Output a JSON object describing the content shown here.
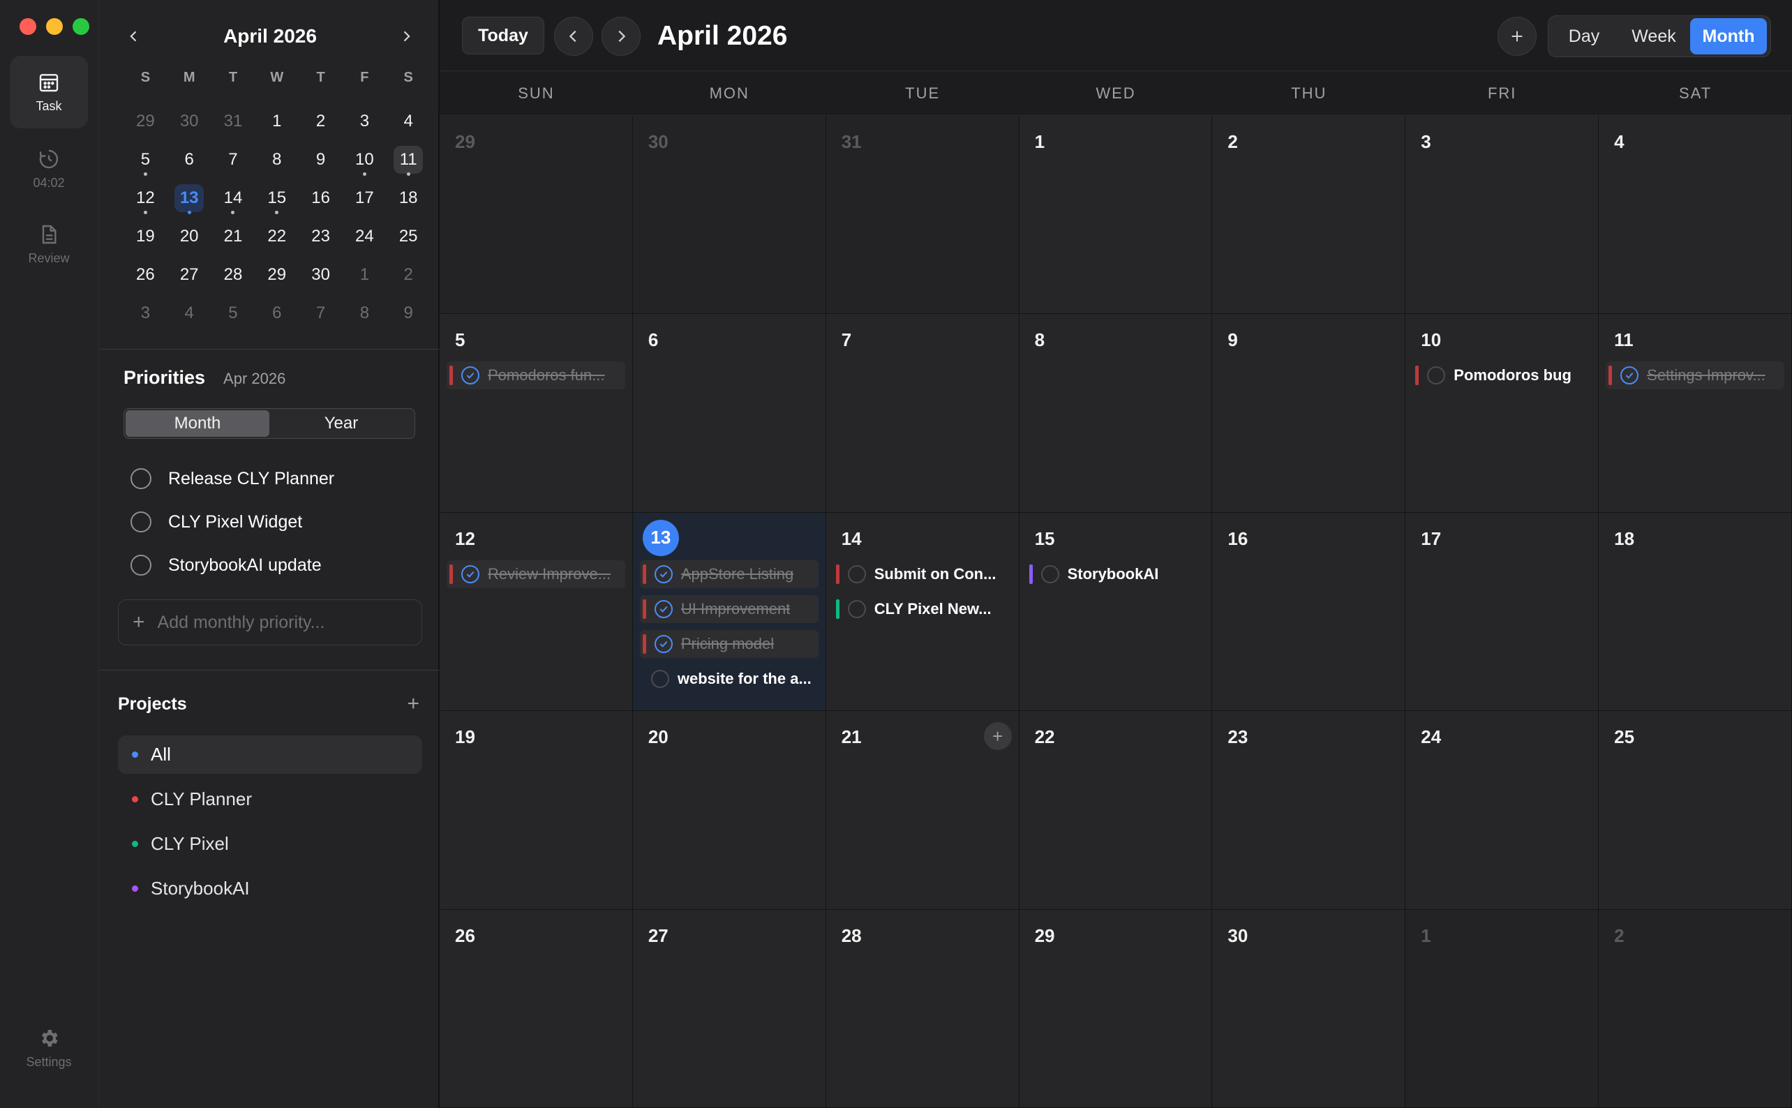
{
  "rail": {
    "task_label": "Task",
    "timer_label": "04:02",
    "review_label": "Review",
    "settings_label": "Settings"
  },
  "mini": {
    "title": "April 2026",
    "dow": [
      "S",
      "M",
      "T",
      "W",
      "T",
      "F",
      "S"
    ],
    "days": [
      {
        "n": "29",
        "muted": true
      },
      {
        "n": "30",
        "muted": true
      },
      {
        "n": "31",
        "muted": true
      },
      {
        "n": "1"
      },
      {
        "n": "2"
      },
      {
        "n": "3"
      },
      {
        "n": "4"
      },
      {
        "n": "5",
        "dot": true
      },
      {
        "n": "6"
      },
      {
        "n": "7"
      },
      {
        "n": "8"
      },
      {
        "n": "9"
      },
      {
        "n": "10",
        "dot": true
      },
      {
        "n": "11",
        "dot": true,
        "selected": true
      },
      {
        "n": "12",
        "dot": true
      },
      {
        "n": "13",
        "dot": true,
        "today": true
      },
      {
        "n": "14",
        "dot": true
      },
      {
        "n": "15",
        "dot": true
      },
      {
        "n": "16"
      },
      {
        "n": "17"
      },
      {
        "n": "18"
      },
      {
        "n": "19"
      },
      {
        "n": "20"
      },
      {
        "n": "21"
      },
      {
        "n": "22"
      },
      {
        "n": "23"
      },
      {
        "n": "24"
      },
      {
        "n": "25"
      },
      {
        "n": "26"
      },
      {
        "n": "27"
      },
      {
        "n": "28"
      },
      {
        "n": "29"
      },
      {
        "n": "30"
      },
      {
        "n": "1",
        "muted": true
      },
      {
        "n": "2",
        "muted": true
      },
      {
        "n": "3",
        "muted": true
      },
      {
        "n": "4",
        "muted": true
      },
      {
        "n": "5",
        "muted": true
      },
      {
        "n": "6",
        "muted": true
      },
      {
        "n": "7",
        "muted": true
      },
      {
        "n": "8",
        "muted": true
      },
      {
        "n": "9",
        "muted": true
      }
    ]
  },
  "priorities": {
    "title": "Priorities",
    "period": "Apr 2026",
    "seg_month": "Month",
    "seg_year": "Year",
    "items": [
      "Release CLY Planner",
      "CLY Pixel Widget",
      "StorybookAI update"
    ],
    "add_placeholder": "Add monthly priority..."
  },
  "projects": {
    "title": "Projects",
    "items": [
      {
        "label": "All",
        "color": "#4b8bf5"
      },
      {
        "label": "CLY Planner",
        "color": "#ef4444"
      },
      {
        "label": "CLY Pixel",
        "color": "#10b981"
      },
      {
        "label": "StorybookAI",
        "color": "#a855f7"
      }
    ]
  },
  "toolbar": {
    "today_label": "Today",
    "title": "April 2026",
    "view_day": "Day",
    "view_week": "Week",
    "view_month": "Month"
  },
  "colors": {
    "planner": "#c0393b",
    "pixel": "#10b981",
    "storybook": "#8b5cf6",
    "accent": "#3b82f6"
  },
  "calendar": {
    "dow": [
      "SUN",
      "MON",
      "TUE",
      "WED",
      "THU",
      "FRI",
      "SAT"
    ],
    "cells": [
      {
        "n": "29",
        "out": true
      },
      {
        "n": "30",
        "out": true
      },
      {
        "n": "31",
        "out": true
      },
      {
        "n": "1"
      },
      {
        "n": "2"
      },
      {
        "n": "3"
      },
      {
        "n": "4"
      },
      {
        "n": "5",
        "events": [
          {
            "t": "Pomodoros fun...",
            "done": true,
            "c": "planner"
          }
        ]
      },
      {
        "n": "6"
      },
      {
        "n": "7"
      },
      {
        "n": "8"
      },
      {
        "n": "9"
      },
      {
        "n": "10",
        "events": [
          {
            "t": "Pomodoros bug",
            "done": false,
            "c": "planner"
          }
        ]
      },
      {
        "n": "11",
        "events": [
          {
            "t": "Settings Improv...",
            "done": true,
            "c": "planner"
          }
        ]
      },
      {
        "n": "12",
        "events": [
          {
            "t": "Review Improve...",
            "done": true,
            "c": "planner"
          }
        ]
      },
      {
        "n": "13",
        "today": true,
        "events": [
          {
            "t": "AppStore Listing",
            "done": true,
            "c": "planner"
          },
          {
            "t": "UI Improvement",
            "done": true,
            "c": "planner"
          },
          {
            "t": "Pricing model",
            "done": true,
            "c": "planner"
          },
          {
            "t": "website for the a...",
            "done": false,
            "c": "none"
          }
        ]
      },
      {
        "n": "14",
        "events": [
          {
            "t": "Submit on Con...",
            "done": false,
            "c": "planner"
          },
          {
            "t": "CLY Pixel New...",
            "done": false,
            "c": "pixel"
          }
        ]
      },
      {
        "n": "15",
        "events": [
          {
            "t": "StorybookAI",
            "done": false,
            "c": "storybook"
          }
        ]
      },
      {
        "n": "16"
      },
      {
        "n": "17"
      },
      {
        "n": "18"
      },
      {
        "n": "19"
      },
      {
        "n": "20"
      },
      {
        "n": "21",
        "add": true
      },
      {
        "n": "22"
      },
      {
        "n": "23"
      },
      {
        "n": "24"
      },
      {
        "n": "25"
      },
      {
        "n": "26"
      },
      {
        "n": "27"
      },
      {
        "n": "28"
      },
      {
        "n": "29"
      },
      {
        "n": "30"
      },
      {
        "n": "1",
        "out": true
      },
      {
        "n": "2",
        "out": true
      }
    ]
  }
}
